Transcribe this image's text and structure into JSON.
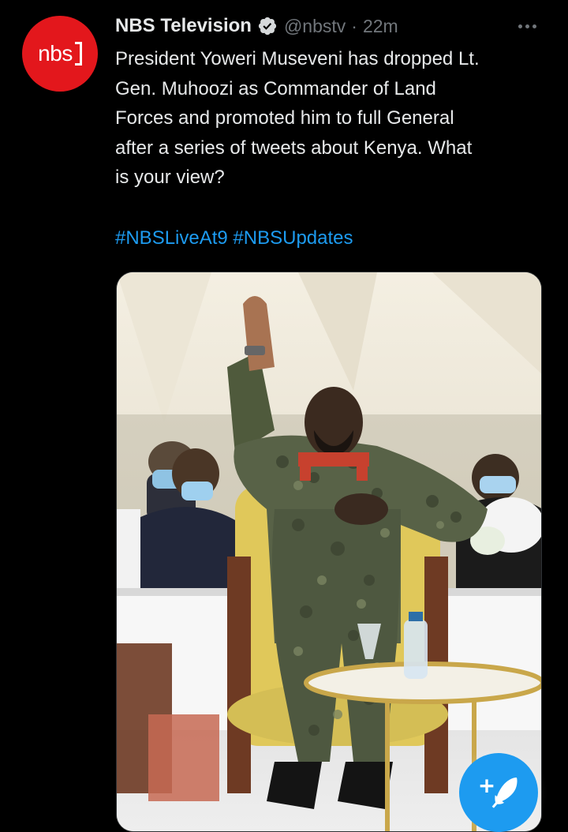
{
  "tweet": {
    "author": {
      "display_name": "NBS Television",
      "handle": "@nbstv",
      "verified": true,
      "avatar_text": "nbs"
    },
    "separator": "·",
    "time": "22m",
    "text": "President Yoweri Museveni has dropped Lt.\nGen. Muhoozi as Commander of Land\nForces and promoted him to full General\nafter a series of tweets about Kenya. What\nis your view?",
    "hashtags": [
      "#NBSLiveAt9",
      "#NBSUpdates"
    ],
    "media": {
      "type": "photo"
    }
  },
  "icons": {
    "verified": "verified-badge-icon",
    "more": "more-options-icon",
    "compose": "compose-tweet-icon"
  },
  "colors": {
    "background": "#000000",
    "text_primary": "#e7e9ea",
    "text_secondary": "#71767b",
    "accent": "#1d9bf0",
    "avatar_bg": "#e3171c"
  }
}
